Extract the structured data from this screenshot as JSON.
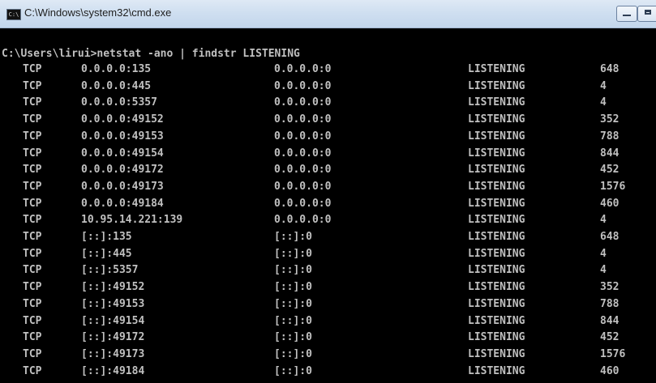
{
  "window": {
    "title": "C:\\Windows\\system32\\cmd.exe",
    "icon_text": "C:\\",
    "accent": "#c3d6ec"
  },
  "console": {
    "prompt": "C:\\Users\\lirui>netstat -ano | findstr LISTENING",
    "rows": [
      {
        "proto": "TCP",
        "local": "0.0.0.0:135",
        "foreign": "0.0.0.0:0",
        "state": "LISTENING",
        "pid": "648"
      },
      {
        "proto": "TCP",
        "local": "0.0.0.0:445",
        "foreign": "0.0.0.0:0",
        "state": "LISTENING",
        "pid": "4"
      },
      {
        "proto": "TCP",
        "local": "0.0.0.0:5357",
        "foreign": "0.0.0.0:0",
        "state": "LISTENING",
        "pid": "4"
      },
      {
        "proto": "TCP",
        "local": "0.0.0.0:49152",
        "foreign": "0.0.0.0:0",
        "state": "LISTENING",
        "pid": "352"
      },
      {
        "proto": "TCP",
        "local": "0.0.0.0:49153",
        "foreign": "0.0.0.0:0",
        "state": "LISTENING",
        "pid": "788"
      },
      {
        "proto": "TCP",
        "local": "0.0.0.0:49154",
        "foreign": "0.0.0.0:0",
        "state": "LISTENING",
        "pid": "844"
      },
      {
        "proto": "TCP",
        "local": "0.0.0.0:49172",
        "foreign": "0.0.0.0:0",
        "state": "LISTENING",
        "pid": "452"
      },
      {
        "proto": "TCP",
        "local": "0.0.0.0:49173",
        "foreign": "0.0.0.0:0",
        "state": "LISTENING",
        "pid": "1576"
      },
      {
        "proto": "TCP",
        "local": "0.0.0.0:49184",
        "foreign": "0.0.0.0:0",
        "state": "LISTENING",
        "pid": "460"
      },
      {
        "proto": "TCP",
        "local": "10.95.14.221:139",
        "foreign": "0.0.0.0:0",
        "state": "LISTENING",
        "pid": "4"
      },
      {
        "proto": "TCP",
        "local": "[::]:135",
        "foreign": "[::]:0",
        "state": "LISTENING",
        "pid": "648"
      },
      {
        "proto": "TCP",
        "local": "[::]:445",
        "foreign": "[::]:0",
        "state": "LISTENING",
        "pid": "4"
      },
      {
        "proto": "TCP",
        "local": "[::]:5357",
        "foreign": "[::]:0",
        "state": "LISTENING",
        "pid": "4"
      },
      {
        "proto": "TCP",
        "local": "[::]:49152",
        "foreign": "[::]:0",
        "state": "LISTENING",
        "pid": "352"
      },
      {
        "proto": "TCP",
        "local": "[::]:49153",
        "foreign": "[::]:0",
        "state": "LISTENING",
        "pid": "788"
      },
      {
        "proto": "TCP",
        "local": "[::]:49154",
        "foreign": "[::]:0",
        "state": "LISTENING",
        "pid": "844"
      },
      {
        "proto": "TCP",
        "local": "[::]:49172",
        "foreign": "[::]:0",
        "state": "LISTENING",
        "pid": "452"
      },
      {
        "proto": "TCP",
        "local": "[::]:49173",
        "foreign": "[::]:0",
        "state": "LISTENING",
        "pid": "1576"
      },
      {
        "proto": "TCP",
        "local": "[::]:49184",
        "foreign": "[::]:0",
        "state": "LISTENING",
        "pid": "460"
      }
    ]
  }
}
